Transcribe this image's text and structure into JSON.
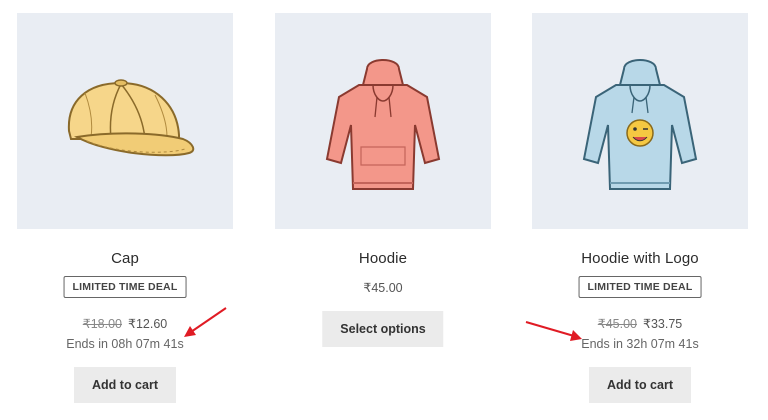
{
  "products": [
    {
      "name": "Cap",
      "badge": "LIMITED TIME DEAL",
      "regular_price": "₹18.00",
      "sale_price": "₹12.60",
      "countdown": "Ends in 08h 07m 41s",
      "button": "Add to cart",
      "image_icon": "cap-image"
    },
    {
      "name": "Hoodie",
      "price": "₹45.00",
      "button": "Select options",
      "image_icon": "hoodie-image"
    },
    {
      "name": "Hoodie with Logo",
      "badge": "LIMITED TIME DEAL",
      "regular_price": "₹45.00",
      "sale_price": "₹33.75",
      "countdown": "Ends in 32h 07m 41s",
      "button": "Add to cart",
      "image_icon": "hoodie-with-logo-image"
    }
  ],
  "colors": {
    "thumb_bg": "#e9edf3",
    "button_bg": "#ebebeb",
    "arrow": "#e01b24",
    "cap": "#f6d68a",
    "hoodie": "#f3978a",
    "hoodie_logo": "#b8d8e8"
  },
  "annotations": [
    "red-arrow-to-countdown-1",
    "red-arrow-to-countdown-3"
  ]
}
